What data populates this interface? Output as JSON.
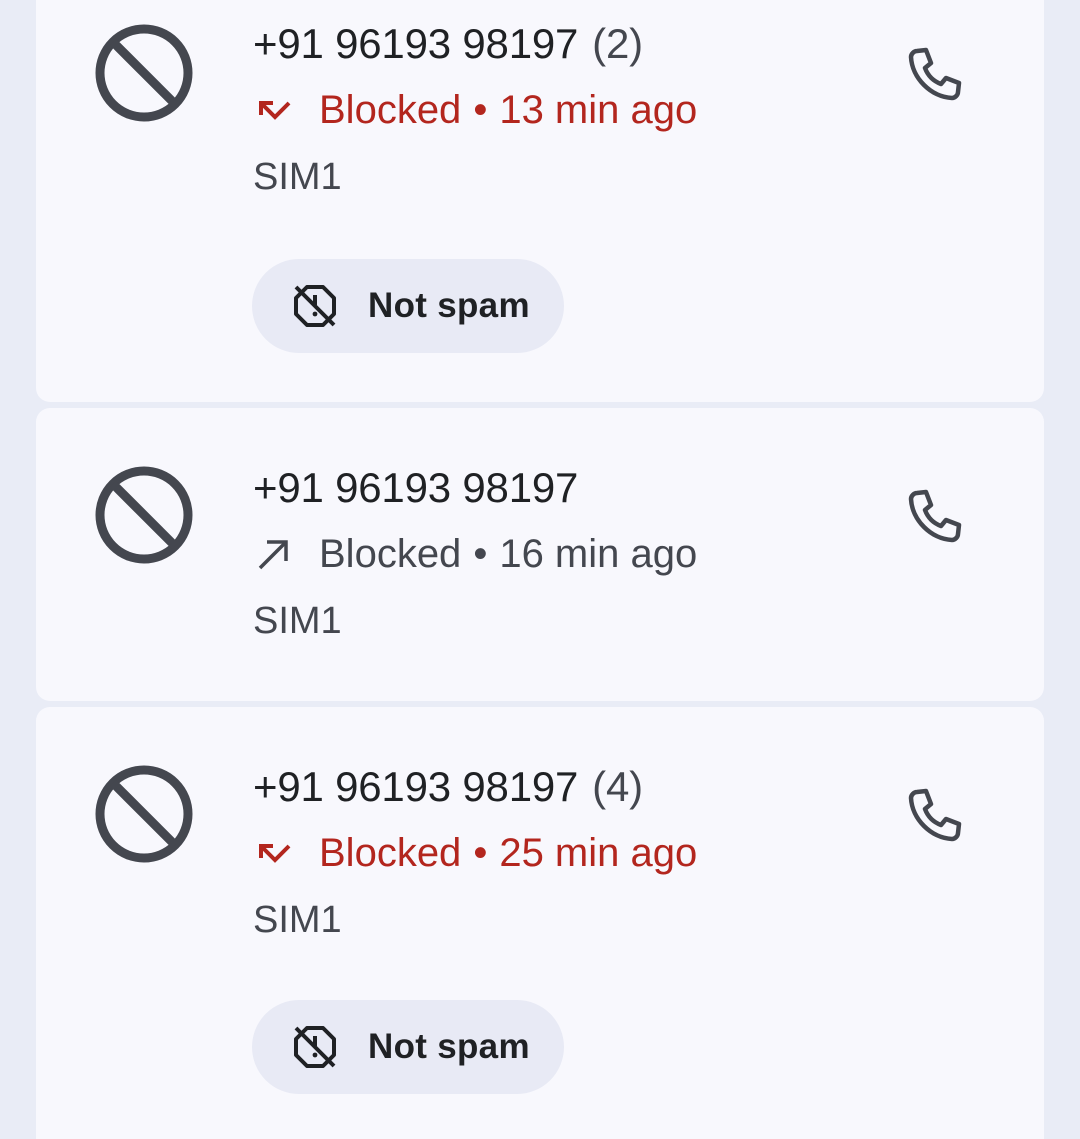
{
  "calls": [
    {
      "number": "+91 96193 98197",
      "count": "(2)",
      "direction_icon": "missed-call-icon",
      "status": "Blocked",
      "separator": "•",
      "time": "13 min ago",
      "sim": "SIM1",
      "status_color": "#b3261e",
      "action_label": "Not spam"
    },
    {
      "number": "+91 96193 98197",
      "count": "",
      "direction_icon": "outgoing-call-icon",
      "status": "Blocked",
      "separator": "•",
      "time": "16 min ago",
      "sim": "SIM1",
      "status_color": "#44474f"
    },
    {
      "number": "+91 96193 98197",
      "count": "(4)",
      "direction_icon": "missed-call-icon",
      "status": "Blocked",
      "separator": "•",
      "time": "25 min ago",
      "sim": "SIM1",
      "status_color": "#b3261e",
      "action_label": "Not spam"
    }
  ],
  "colors": {
    "background": "#e9ecf6",
    "card": "#f8f8fd",
    "missed": "#b3261e",
    "icon": "#44474f",
    "chip": "#e8eaf5"
  }
}
